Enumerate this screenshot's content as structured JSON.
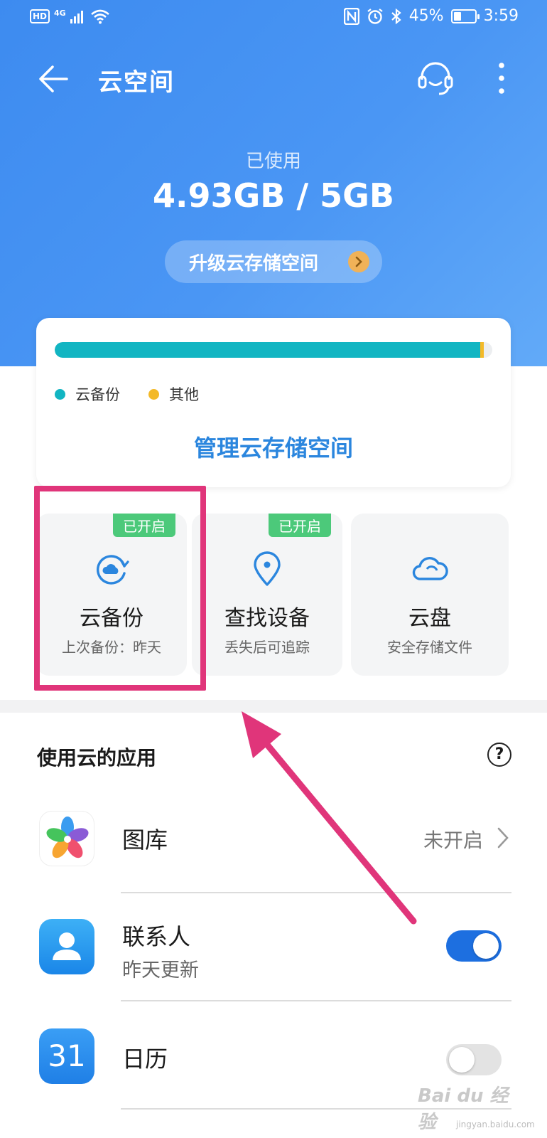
{
  "status_bar": {
    "hd": "HD",
    "network": "4G",
    "battery": "45%",
    "battery_level": 0.45,
    "time": "3:59"
  },
  "header": {
    "title": "云空间"
  },
  "usage": {
    "label": "已使用",
    "value": "4.93GB / 5GB",
    "upgrade_label": "升级云存储空间"
  },
  "storage_card": {
    "cloud_backup_fraction": 0.972,
    "other_fraction": 0.008,
    "legend": [
      "云备份",
      "其他"
    ],
    "manage_label": "管理云存储空间"
  },
  "tiles": [
    {
      "badge": "已开启",
      "title": "云备份",
      "subtitle": "上次备份：昨天",
      "icon": "cloud-sync-icon"
    },
    {
      "badge": "已开启",
      "title": "查找设备",
      "subtitle": "丢失后可追踪",
      "icon": "location-pin-icon"
    },
    {
      "badge": "",
      "title": "云盘",
      "subtitle": "安全存储文件",
      "icon": "cloud-drive-icon"
    }
  ],
  "apps_section": {
    "title": "使用云的应用",
    "help": "?"
  },
  "apps": [
    {
      "name": "图库",
      "status": "未开启",
      "icon": "gallery-icon"
    },
    {
      "name": "联系人",
      "subtitle": "昨天更新",
      "toggle": true,
      "icon": "contacts-icon"
    },
    {
      "name": "日历",
      "icon_text": "31",
      "toggle": false,
      "icon": "calendar-icon"
    }
  ],
  "colors": {
    "header_blue": "#4a96f4",
    "cloud_teal": "#12b5c2",
    "other_yellow": "#f3b928",
    "link_blue": "#2b86de",
    "badge_green": "#4cc97a",
    "highlight_pink": "#e0357a",
    "toggle_on": "#1d6fe0"
  },
  "watermark": {
    "text": "Bai du 经验",
    "sub": "jingyan.baidu.com"
  }
}
